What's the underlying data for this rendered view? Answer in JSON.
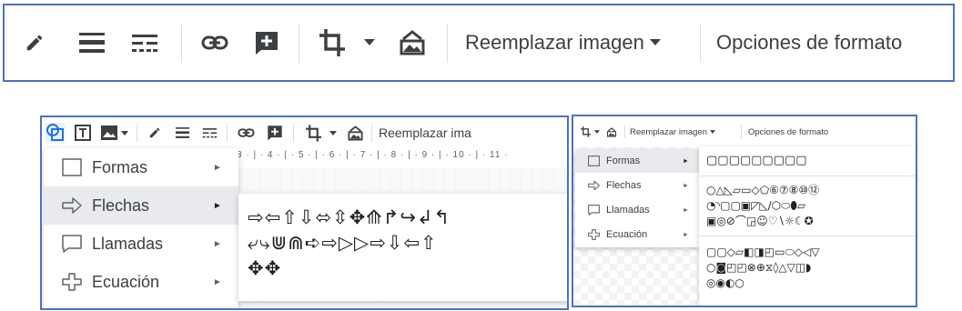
{
  "toolbar": {
    "icons": [
      "pencil-icon",
      "line-weight-icon",
      "line-dash-icon",
      "link-icon",
      "add-comment-icon",
      "crop-icon",
      "dropdown-arrow-icon",
      "reset-image-icon"
    ],
    "replace_image_label": "Reemplazar imagen",
    "format_options_label": "Opciones de formato",
    "icon_color": "#3c4043"
  },
  "left_screenshot": {
    "toolbar_icons": [
      "shape-icon",
      "text-box-icon",
      "image-icon",
      "pencil-icon",
      "line-weight-icon",
      "line-dash-icon",
      "link-icon",
      "add-comment-icon",
      "crop-icon",
      "reset-image-icon"
    ],
    "replace_image_label_truncated": "Reemplazar ima",
    "ruler_text": "3 · | · 4 · | · 5 · | · 6 · | · 7 · | · 8 · | · 9 · | · 10 · | · 11 ·",
    "menu_items": [
      {
        "label": "Formas",
        "icon": "square-icon",
        "active": false
      },
      {
        "label": "Flechas",
        "icon": "arrow-right-outline-icon",
        "active": true
      },
      {
        "label": "Llamadas",
        "icon": "callout-icon",
        "active": false
      },
      {
        "label": "Ecuación",
        "icon": "plus-outline-icon",
        "active": false
      }
    ],
    "arrow_glyph": "►",
    "arrow_shape_rows": [
      "⇨⇦⇧⇩⬄⇳✥⟰↱↪↲↰",
      "⤶⤷⋓⋒➪⇨▷▷⇨⇩⇦⇧",
      "✥✥"
    ]
  },
  "right_screenshot": {
    "replace_image_label": "Reemplazar imagen",
    "format_options_label": "Opciones de formato",
    "menu_items": [
      {
        "label": "Formas",
        "icon": "square-icon",
        "active": true
      },
      {
        "label": "Flechas",
        "icon": "arrow-right-outline-icon",
        "active": false
      },
      {
        "label": "Llamadas",
        "icon": "callout-icon",
        "active": false
      },
      {
        "label": "Ecuación",
        "icon": "plus-outline-icon",
        "active": false
      }
    ],
    "arrow_glyph": "►",
    "shape_rows": [
      "▢▢▢▢▢▢▢▢▢",
      "○△◺▱▭◇⬠⑥⑦⑧⑩⑫",
      "◔◝▢▢▣◸◺∕⬡⬭⬮▱",
      "▣◎⊘⌒◲☺♡∖☼☾✪",
      "▢▢◇▱◧◨◰▭⬭◇◁▽",
      "○◙◰◰⊗⊕⧖◊△▽◫◗",
      "◎◉◐○"
    ]
  }
}
